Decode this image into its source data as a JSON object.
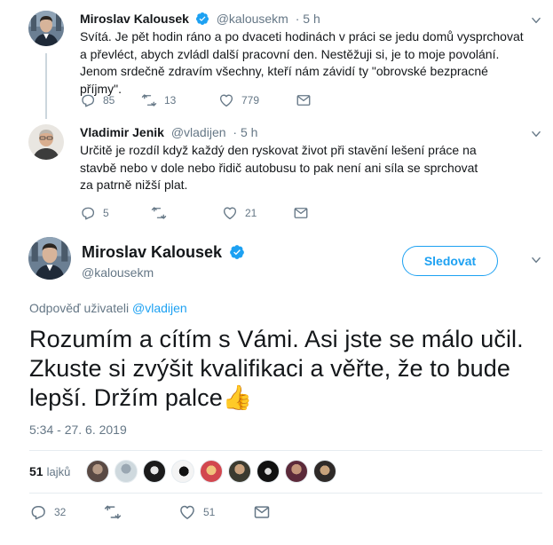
{
  "tweet1": {
    "name": "Miroslav Kalousek",
    "handle": "@kalousekm",
    "time": "· 5 h",
    "text": "Svítá. Je pět hodin ráno a po dvaceti hodinách v práci se jedu domů vysprchovat a převléct, abych zvládl další pracovní den. Nestěžuji si, je to moje povolání. Jenom srdečně zdravím všechny, kteří nám závidí ty \"obrovské bezpracné příjmy\".",
    "replies": "85",
    "retweets": "13",
    "likes": "779"
  },
  "tweet2": {
    "name": "Vladimir Jenik",
    "handle": "@vladijen",
    "time": "· 5 h",
    "text": "Určitě je rozdíl když každý den ryskovat život při stavění lešení práce na stavbě nebo v dole nebo řidič autobusu to pak není ani síla se sprchovat za patrně nižší plat.",
    "replies": "5",
    "retweets": "",
    "likes": "21"
  },
  "main": {
    "name": "Miroslav Kalousek",
    "handle": "@kalousekm",
    "follow_label": "Sledovat",
    "reply_prefix": "Odpověď uživateli",
    "reply_handle": "@vladijen",
    "text": "Rozumím a cítím s Vámi. Asi jste se málo učil. Zkuste si zvýšit kvalifikaci a věřte, že to bude lepší. Držím palce",
    "emoji": "👍",
    "timestamp": "5:34 - 27. 6. 2019",
    "likes_count": "51",
    "likes_label": "lajků",
    "replies": "32",
    "retweets": "",
    "likes": "51"
  },
  "colors": {
    "accent": "#1da1f2",
    "secondary_text": "#657786",
    "divider": "#e6ecf0"
  },
  "icons": [
    "verified-badge-icon",
    "reply-icon",
    "retweet-icon",
    "like-icon",
    "message-icon",
    "caret-down-icon"
  ]
}
